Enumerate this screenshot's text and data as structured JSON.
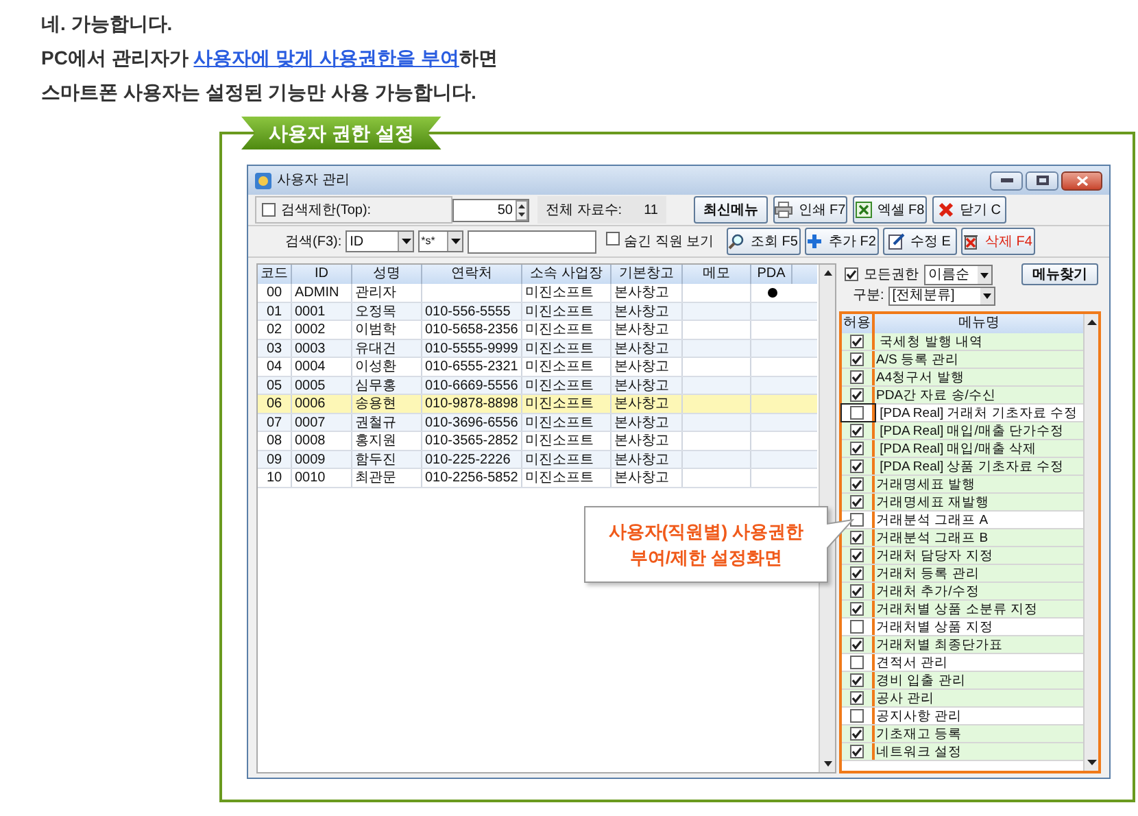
{
  "intro": {
    "line1": "네. 가능합니다.",
    "line2_before": "PC에서 관리자가 ",
    "line2_link": "사용자에 맞게 사용권한을 부여",
    "line2_after": "하면",
    "line3": "스마트폰 사용자는 설정된 기능만 사용 가능합니다."
  },
  "section_title": "사용자 권한 설정",
  "window": {
    "title": "사용자 관리",
    "top_limit": {
      "label": "검색제한(Top):",
      "checked": false,
      "value": "50"
    },
    "total_label": "전체 자료수:",
    "total_value": "11",
    "buttons_row1": [
      {
        "kind": "plain",
        "label": "최신메뉴"
      },
      {
        "kind": "print",
        "label": "인쇄 F7"
      },
      {
        "kind": "excel",
        "label": "엑셀 F8"
      },
      {
        "kind": "close",
        "label": "닫기 C"
      }
    ],
    "search_label": "검색(F3):",
    "search_field": "ID",
    "search_operator": "*s*",
    "hidden_staff": {
      "label": "숨긴 직원 보기",
      "checked": false
    },
    "buttons_row2": [
      {
        "kind": "search",
        "label": "조회 F5"
      },
      {
        "kind": "add",
        "label": "추가 F2"
      },
      {
        "kind": "edit",
        "label": "수정 E"
      },
      {
        "kind": "delete",
        "label": "삭제 F4"
      }
    ],
    "grid": {
      "columns": [
        "코드",
        "ID",
        "성명",
        "연락처",
        "소속 사업장",
        "기본창고",
        "메모",
        "PDA"
      ],
      "rows": [
        {
          "cells": [
            "00",
            "ADMIN",
            "관리자",
            "",
            "미진소프트",
            "본사창고",
            ""
          ],
          "pda": true,
          "selected": false
        },
        {
          "cells": [
            "01",
            "0001",
            "오정목",
            "010-556-5555",
            "미진소프트",
            "본사창고",
            ""
          ],
          "pda": false,
          "selected": false
        },
        {
          "cells": [
            "02",
            "0002",
            "이범학",
            "010-5658-2356",
            "미진소프트",
            "본사창고",
            ""
          ],
          "pda": false,
          "selected": false
        },
        {
          "cells": [
            "03",
            "0003",
            "유대건",
            "010-5555-9999",
            "미진소프트",
            "본사창고",
            ""
          ],
          "pda": false,
          "selected": false
        },
        {
          "cells": [
            "04",
            "0004",
            "이성환",
            "010-6555-2321",
            "미진소프트",
            "본사창고",
            ""
          ],
          "pda": false,
          "selected": false
        },
        {
          "cells": [
            "05",
            "0005",
            "심무홍",
            "010-6669-5556",
            "미진소프트",
            "본사창고",
            ""
          ],
          "pda": false,
          "selected": false
        },
        {
          "cells": [
            "06",
            "0006",
            "송용현",
            "010-9878-8898",
            "미진소프트",
            "본사창고",
            ""
          ],
          "pda": false,
          "selected": true
        },
        {
          "cells": [
            "07",
            "0007",
            "권철규",
            "010-3696-6556",
            "미진소프트",
            "본사창고",
            ""
          ],
          "pda": false,
          "selected": false
        },
        {
          "cells": [
            "08",
            "0008",
            "홍지원",
            "010-3565-2852",
            "미진소프트",
            "본사창고",
            ""
          ],
          "pda": false,
          "selected": false
        },
        {
          "cells": [
            "09",
            "0009",
            "함두진",
            "010-225-2226",
            "미진소프트",
            "본사창고",
            ""
          ],
          "pda": false,
          "selected": false
        },
        {
          "cells": [
            "10",
            "0010",
            "최관문",
            "010-2256-5852",
            "미진소프트",
            "본사창고",
            ""
          ],
          "pda": false,
          "selected": false
        }
      ]
    },
    "all_permissions": {
      "label": "모든권한",
      "checked": true
    },
    "sort": "이름순",
    "find_button": "메뉴찾기",
    "category_label": "구분:",
    "category": "[전체분류]",
    "menu_columns": [
      "허용",
      "메뉴명"
    ],
    "menus": [
      {
        "name": " 국세청 발행 내역",
        "checked": true,
        "selected": false
      },
      {
        "name": "A/S 등록 관리",
        "checked": true,
        "selected": false
      },
      {
        "name": "A4청구서 발행",
        "checked": true,
        "selected": false
      },
      {
        "name": "PDA간 자료 송/수신",
        "checked": true,
        "selected": false
      },
      {
        "name": " [PDA Real] 거래처 기초자료 수정",
        "checked": false,
        "selected": true
      },
      {
        "name": " [PDA Real] 매입/매출 단가수정",
        "checked": true,
        "selected": false
      },
      {
        "name": " [PDA Real] 매입/매출 삭제",
        "checked": true,
        "selected": false
      },
      {
        "name": " [PDA Real] 상품 기초자료 수정",
        "checked": true,
        "selected": false
      },
      {
        "name": "거래명세표 발행",
        "checked": true,
        "selected": false
      },
      {
        "name": "거래명세표 재발행",
        "checked": true,
        "selected": false
      },
      {
        "name": "거래분석 그래프 A",
        "checked": false,
        "selected": false
      },
      {
        "name": "거래분석 그래프 B",
        "checked": true,
        "selected": false
      },
      {
        "name": "거래처 담당자 지정",
        "checked": true,
        "selected": false
      },
      {
        "name": "거래처 등록 관리",
        "checked": true,
        "selected": false
      },
      {
        "name": "거래처 추가/수정",
        "checked": true,
        "selected": false
      },
      {
        "name": "거래처별 상품 소분류 지정",
        "checked": true,
        "selected": false
      },
      {
        "name": "거래처별 상품 지정",
        "checked": false,
        "selected": false
      },
      {
        "name": "거래처별 최종단가표",
        "checked": true,
        "selected": false
      },
      {
        "name": "견적서 관리",
        "checked": false,
        "selected": false
      },
      {
        "name": "경비 입출 관리",
        "checked": true,
        "selected": false
      },
      {
        "name": "공사 관리",
        "checked": true,
        "selected": false
      },
      {
        "name": "공지사항 관리",
        "checked": false,
        "selected": false
      },
      {
        "name": "기초재고 등록",
        "checked": true,
        "selected": false
      },
      {
        "name": "네트워크 설정",
        "checked": true,
        "selected": false
      }
    ]
  },
  "callout": [
    "사용자(직원별) 사용권한",
    "부여/제한 설정화면"
  ]
}
